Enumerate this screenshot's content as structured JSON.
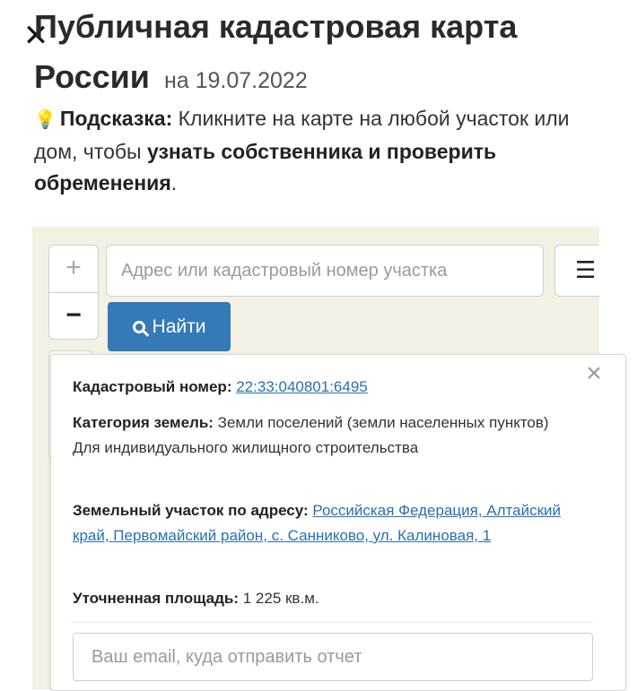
{
  "header": {
    "title": "Публичная кадастровая карта России",
    "date": "на 19.07.2022",
    "close_symbol": "✕"
  },
  "hint": {
    "bulb_icon": "lightbulb-icon",
    "label": "Подсказка:",
    "text_1": "Кликните на карте на любой участок или дом, чтобы",
    "bold_text": "узнать собственника и проверить обременения",
    "end": "."
  },
  "map": {
    "zoom_in": "+",
    "zoom_out": "−",
    "search_placeholder": "Адрес или кадастровый номер участка",
    "menu_icon": "☰",
    "find_label": "Найти"
  },
  "popup": {
    "close": "×",
    "cadastral_label": "Кадастровый номер:",
    "cadastral_value": "22:33:040801:6495",
    "category_label": "Категория земель:",
    "category_value": "Земли поселений (земли населенных пунктов)",
    "category_use": "Для индивидуального жилищного строительства",
    "address_label": "Земельный участок по адресу:",
    "address_value": "Российская Федерация, Алтайский край, Первомайский район, с. Санниково, ул. Калиновая, 1",
    "area_label": "Уточненная площадь:",
    "area_value": "1 225 кв.м.",
    "email_placeholder": "Ваш email, куда отправить отчет"
  }
}
